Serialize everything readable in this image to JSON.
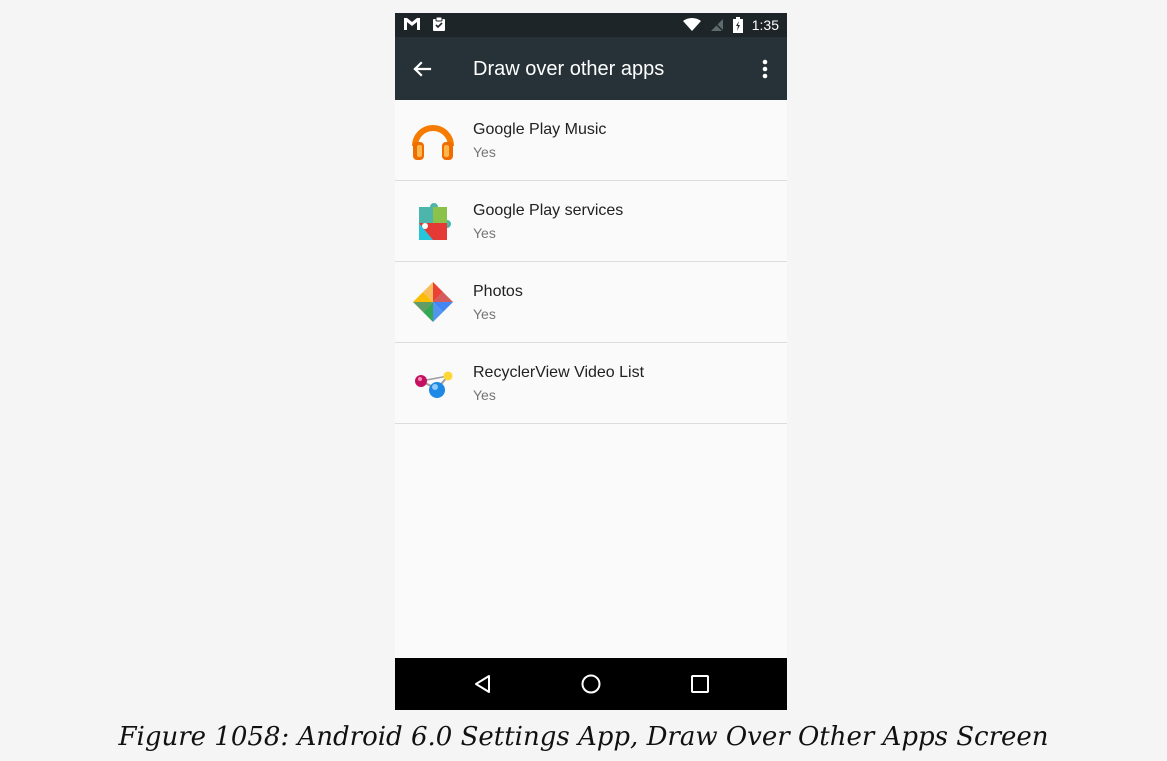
{
  "status_bar": {
    "time": "1:35",
    "left_icons": [
      "gmail-icon",
      "clipboard-check-icon"
    ],
    "right_icons": [
      "wifi-icon",
      "no-sim-icon",
      "battery-charging-icon"
    ]
  },
  "toolbar": {
    "title": "Draw over other apps",
    "back_icon": "arrow-back-icon",
    "menu_icon": "more-vert-icon"
  },
  "apps": [
    {
      "name": "Google Play Music",
      "status": "Yes",
      "icon": "headphones-icon"
    },
    {
      "name": "Google Play services",
      "status": "Yes",
      "icon": "puzzle-icon"
    },
    {
      "name": "Photos",
      "status": "Yes",
      "icon": "pinwheel-icon"
    },
    {
      "name": "RecyclerView Video List",
      "status": "Yes",
      "icon": "molecule-icon"
    }
  ],
  "nav_bar": {
    "buttons": [
      "back-triangle-icon",
      "home-circle-icon",
      "recents-square-icon"
    ]
  },
  "caption": "Figure 1058: Android 6.0 Settings App, Draw Over Other Apps Screen",
  "colors": {
    "toolbar": "#263238",
    "status_bar": "#1e2529",
    "background": "#fafafa",
    "nav_bar": "#000000"
  }
}
